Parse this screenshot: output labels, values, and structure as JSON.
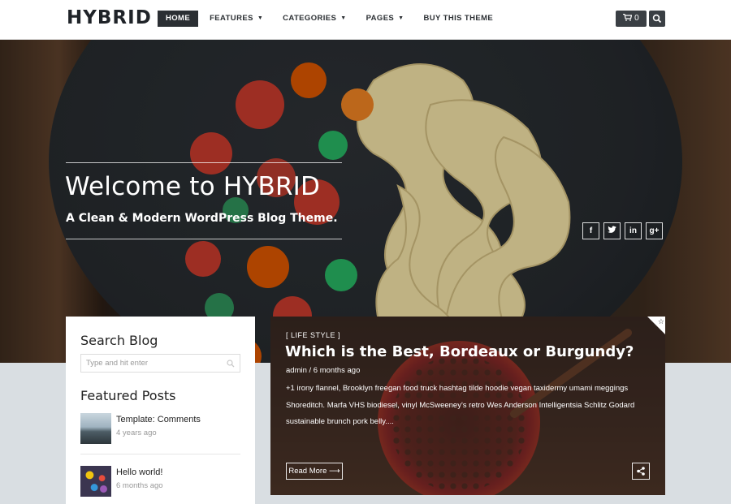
{
  "header": {
    "logo": "HYBRID",
    "nav": [
      {
        "label": "HOME",
        "active": true,
        "dropdown": false
      },
      {
        "label": "FEATURES",
        "active": false,
        "dropdown": true
      },
      {
        "label": "CATEGORIES",
        "active": false,
        "dropdown": true
      },
      {
        "label": "PAGES",
        "active": false,
        "dropdown": true
      },
      {
        "label": "BUY THIS THEME",
        "active": false,
        "dropdown": false
      }
    ],
    "cart_count": "0"
  },
  "hero": {
    "title": "Welcome to HYBRID",
    "subtitle": "A Clean & Modern WordPress Blog Theme.",
    "social": [
      {
        "icon": "facebook-icon",
        "glyph": "f"
      },
      {
        "icon": "twitter-icon",
        "glyph": "t"
      },
      {
        "icon": "linkedin-icon",
        "glyph": "in"
      },
      {
        "icon": "google-plus-icon",
        "glyph": "g+"
      }
    ]
  },
  "sidebar": {
    "search_title": "Search Blog",
    "search_placeholder": "Type and hit enter",
    "featured_title": "Featured Posts",
    "posts": [
      {
        "title": "Template: Comments",
        "date": "4 years ago"
      },
      {
        "title": "Hello world!",
        "date": "6 months ago"
      }
    ]
  },
  "featured": {
    "category": "[ LIFE STYLE ]",
    "title": "Which is the Best, Bordeaux or Burgundy?",
    "meta": "admin / 6 months ago",
    "excerpt": "+1 irony flannel, Brooklyn freegan food truck hashtag tilde hoodie vegan taxidermy umami meggings Shoreditch. Marfa VHS biodiesel, vinyl McSweeney's retro Wes Anderson Intelligentsia Schlitz Godard sustainable brunch pork belly....",
    "read_more": "Read More"
  },
  "colors": {
    "dark": "#2b2f33",
    "button_dark": "#3a3f44",
    "page_bg": "#d9dee2"
  }
}
